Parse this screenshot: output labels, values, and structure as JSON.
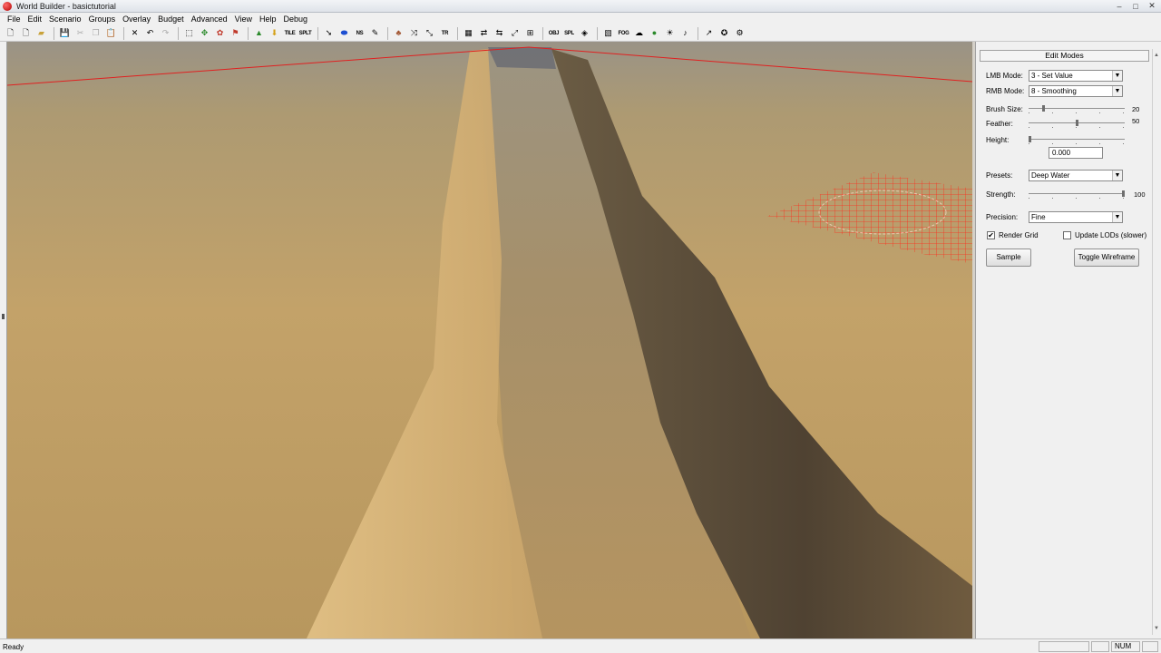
{
  "window": {
    "title": "World Builder - basictutorial",
    "controls": [
      "–",
      "□",
      "✕"
    ]
  },
  "menubar": {
    "items": [
      "File",
      "Edit",
      "Scenario",
      "Groups",
      "Overlay",
      "Budget",
      "Advanced",
      "View",
      "Help",
      "Debug"
    ]
  },
  "toolbar": {
    "text_buttons": {
      "tile": "TILE",
      "splat": "SPLT",
      "ns": "NS",
      "tr": "TR",
      "obj": "OBJ",
      "spl": "SPL",
      "fog": "FOG"
    }
  },
  "panel": {
    "header": "Edit Modes",
    "lmb_mode": {
      "label": "LMB Mode:",
      "value": "3 - Set Value"
    },
    "rmb_mode": {
      "label": "RMB Mode:",
      "value": "8 - Smoothing"
    },
    "brush_size": {
      "label": "Brush Size:",
      "value": "20",
      "fraction": 0.15
    },
    "feather": {
      "label": "Feather:",
      "value": "50",
      "fraction": 0.5
    },
    "height": {
      "label": "Height:",
      "value": "0.000",
      "fraction": 0.0
    },
    "presets": {
      "label": "Presets:",
      "value": "Deep Water"
    },
    "strength": {
      "label": "Strength:",
      "value": "100",
      "fraction": 1.0
    },
    "precision": {
      "label": "Precision:",
      "value": "Fine"
    },
    "render_grid": {
      "label": "Render Grid",
      "checked": true,
      "mark": "✔"
    },
    "update_lods": {
      "label": "Update LODs (slower)",
      "checked": false,
      "mark": ""
    },
    "sample_button": "Sample",
    "toggle_wireframe_button": "Toggle Wireframe"
  },
  "statusbar": {
    "status": "Ready",
    "num": "NUM"
  },
  "colors": {
    "grid": "#ff2a1a",
    "sand": "#c9a56a",
    "shadow": "#5a4a36"
  }
}
